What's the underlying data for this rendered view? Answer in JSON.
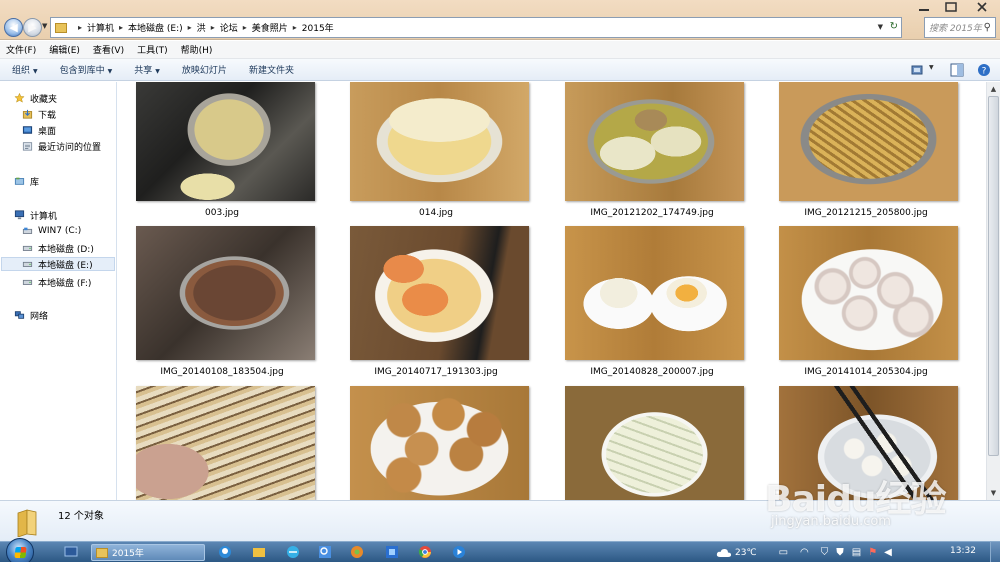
{
  "address": {
    "crumbs": [
      "计算机",
      "本地磁盘 (E:)",
      "洪",
      "论坛",
      "美食照片",
      "2015年"
    ],
    "search_placeholder": "搜索 2015年"
  },
  "menu": [
    "文件(F)",
    "编辑(E)",
    "查看(V)",
    "工具(T)",
    "帮助(H)"
  ],
  "toolbar": {
    "organize": "组织",
    "include": "包含到库中",
    "share": "共享",
    "slideshow": "放映幻灯片",
    "newfolder": "新建文件夹"
  },
  "nav": {
    "favorites": "收藏夹",
    "downloads": "下载",
    "desktop": "桌面",
    "recent": "最近访问的位置",
    "libraries": "库",
    "computer": "计算机",
    "c": "WIN7 (C:)",
    "d": "本地磁盘 (D:)",
    "e": "本地磁盘 (E:)",
    "f": "本地磁盘 (F:)",
    "network": "网络"
  },
  "files": [
    {
      "name": "003.jpg",
      "icon": "photo-corn-pot"
    },
    {
      "name": "014.jpg",
      "icon": "photo-sponge-cake"
    },
    {
      "name": "IMG_20121202_174749.jpg",
      "icon": "photo-radish-soup"
    },
    {
      "name": "IMG_20121215_205800.jpg",
      "icon": "photo-fries-pan"
    },
    {
      "name": "IMG_20140108_183504.jpg",
      "icon": "photo-porridge"
    },
    {
      "name": "IMG_20140717_191303.jpg",
      "icon": "photo-shrimp-bowl"
    },
    {
      "name": "IMG_20140828_200007.jpg",
      "icon": "photo-pear-dessert"
    },
    {
      "name": "IMG_20141014_205304.jpg",
      "icon": "photo-lotus-root"
    },
    {
      "name": "",
      "icon": "photo-nougat"
    },
    {
      "name": "",
      "icon": "photo-fried-chicken"
    },
    {
      "name": "",
      "icon": "photo-yam-slices"
    },
    {
      "name": "",
      "icon": "photo-taro-bowl"
    }
  ],
  "status": {
    "count": "12 个对象"
  },
  "taskbar": {
    "active_window": "2015年",
    "temperature": "23℃",
    "time": "13:32"
  },
  "watermark": {
    "logo": "Baidu经验",
    "url": "jingyan.baidu.com"
  }
}
